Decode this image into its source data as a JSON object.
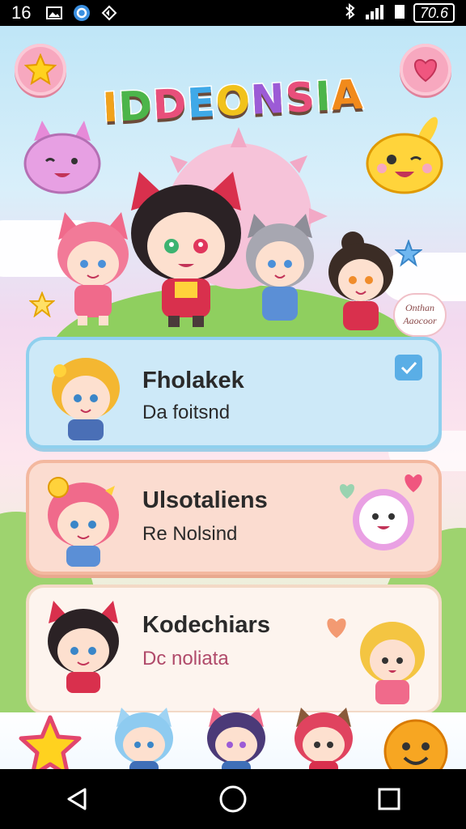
{
  "status_bar": {
    "time": "16",
    "battery": "70.6",
    "icons": [
      "gallery-icon",
      "app-icon",
      "nav-icon",
      "bluetooth-icon",
      "signal-icon"
    ]
  },
  "app": {
    "title": "IDDEONSIA",
    "corner_left_icon": "star-icon",
    "corner_right_icon": "heart-icon",
    "sign_text": "Onthan\nAaocoor"
  },
  "cards": [
    {
      "title": "Fholakek",
      "subtitle": "Da foitsnd",
      "color": "#cfeaf8",
      "border": "#8fd0ee",
      "badge": "check-icon"
    },
    {
      "title": "Ulsotaliens",
      "subtitle": "Re Nolsind",
      "color": "#fbdcd0",
      "border": "#f3b89f",
      "badge": "smiley-bubble-icon"
    },
    {
      "title": "Kodechiars",
      "subtitle": "Dc noliata",
      "color": "#fdf4ee",
      "border": "#f3d9c6",
      "badge": "heart-icon"
    }
  ],
  "colors": {
    "title_letters": [
      "#f1a21b",
      "#4cb54a",
      "#e84f7b",
      "#3fa9e8",
      "#f1c21b",
      "#9c5bd6",
      "#e84f7b",
      "#4cb54a",
      "#f18a1b"
    ],
    "subtitle_3": "#b04a6a"
  },
  "navbar": [
    "back-icon",
    "home-icon",
    "recents-icon"
  ]
}
